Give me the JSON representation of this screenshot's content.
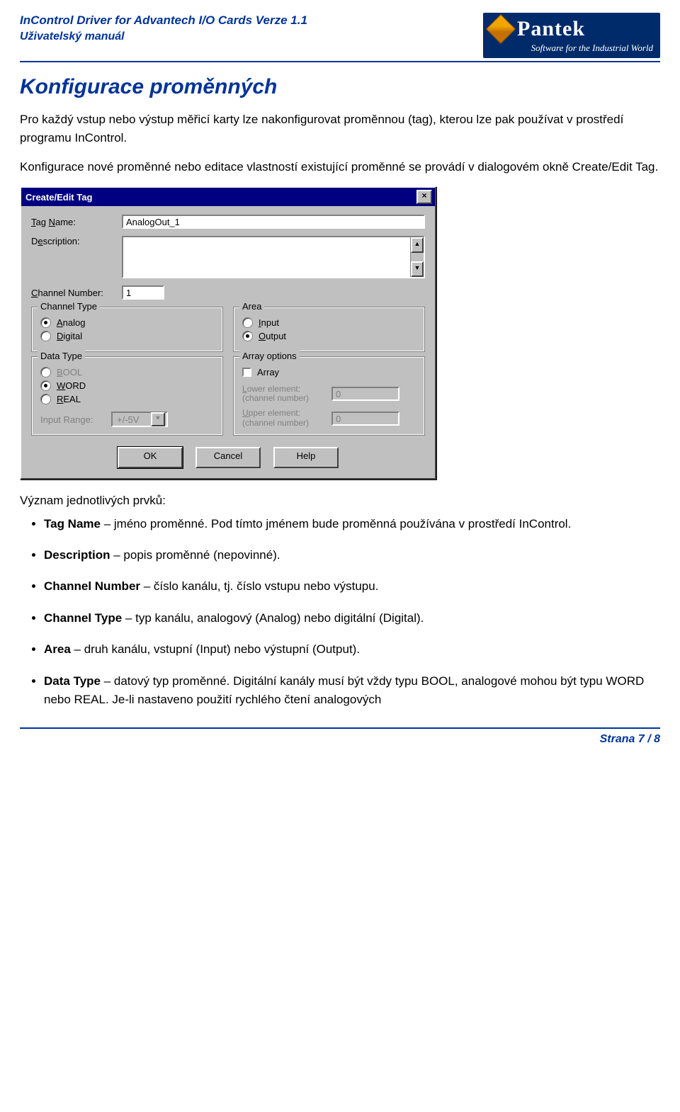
{
  "header": {
    "title_line1": "InControl Driver for Advantech I/O Cards   Verze 1.1",
    "title_line2": "Uživatelský manuál",
    "company_name": "Pantek",
    "company_tagline": "Software for the Industrial World"
  },
  "section_title": "Konfigurace proměnných",
  "intro_para1": "Pro každý vstup nebo výstup měřicí karty lze nakonfigurovat proměnnou (tag), kterou lze pak používat v prostředí programu InControl.",
  "intro_para2": "Konfigurace nové proměnné nebo editace vlastností existující proměnné se provádí v dialogovém okně Create/Edit Tag.",
  "dialog": {
    "title": "Create/Edit Tag",
    "close_glyph": "×",
    "tag_name_label": "Tag Name:",
    "tag_name_value": "AnalogOut_1",
    "description_label": "Description:",
    "description_value": "",
    "channel_number_label": "Channel Number:",
    "channel_number_value": "1",
    "channel_type": {
      "legend": "Channel Type",
      "analog_label": "Analog",
      "digital_label": "Digital",
      "selected": "analog"
    },
    "area": {
      "legend": "Area",
      "input_label": "Input",
      "output_label": "Output",
      "selected": "output"
    },
    "data_type": {
      "legend": "Data Type",
      "bool_label": "BOOL",
      "word_label": "WORD",
      "real_label": "REAL",
      "selected": "word",
      "input_range_label": "Input Range:",
      "input_range_value": "+/-5V"
    },
    "array_options": {
      "legend": "Array options",
      "array_label": "Array",
      "lower_label_line1": "Lower element:",
      "lower_label_line2": "(channel number)",
      "lower_value": "0",
      "upper_label_line1": "Upper element:",
      "upper_label_line2": "(channel number)",
      "upper_value": "0"
    },
    "buttons": {
      "ok": "OK",
      "cancel": "Cancel",
      "help": "Help"
    }
  },
  "list_intro": "Význam jednotlivých prvků:",
  "bullets": [
    {
      "bold": "Tag Name",
      "rest": " – jméno proměnné. Pod tímto jménem bude proměnná používána v prostředí InControl."
    },
    {
      "bold": "Description",
      "rest": " – popis proměnné (nepovinné)."
    },
    {
      "bold": "Channel Number",
      "rest": " – číslo kanálu, tj. číslo vstupu nebo výstupu."
    },
    {
      "bold": "Channel Type",
      "rest": " – typ kanálu, analogový (Analog) nebo digitální (Digital)."
    },
    {
      "bold": "Area",
      "rest": " – druh kanálu, vstupní (Input) nebo výstupní (Output)."
    },
    {
      "bold": "Data Type",
      "rest": " – datový typ proměnné. Digitální kanály musí být vždy typu BOOL, analogové mohou být typu WORD nebo REAL. Je-li nastaveno použití rychlého čtení analogových"
    }
  ],
  "footer": "Strana 7 / 8"
}
